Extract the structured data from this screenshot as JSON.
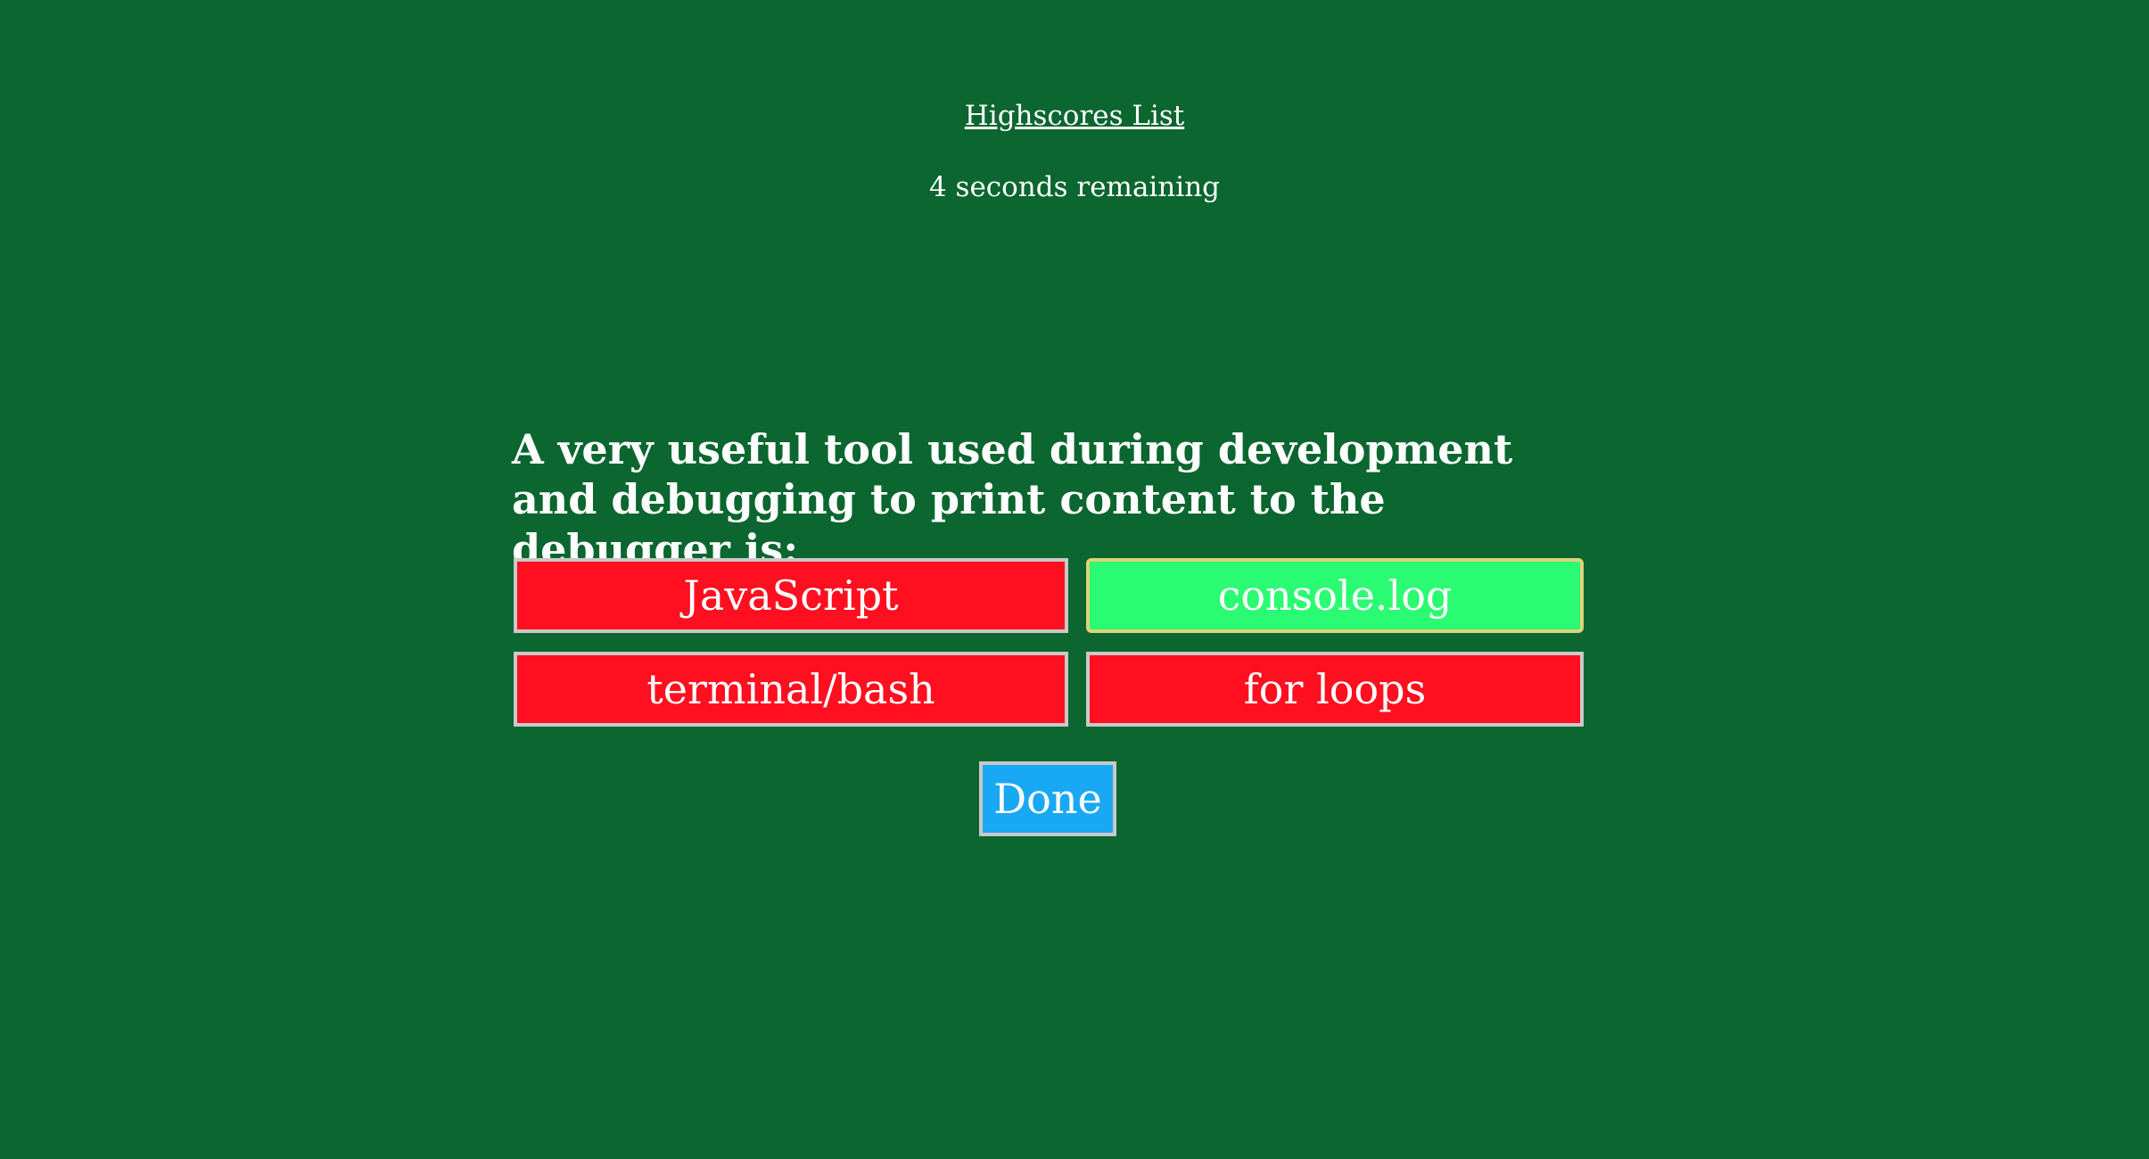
{
  "header": {
    "highscores_link": "Highscores List",
    "timer_text": "4 seconds remaining"
  },
  "quiz": {
    "question": "A very useful tool used during development and debugging to print content to the debugger is:",
    "choices": [
      {
        "label": "JavaScript",
        "state": "incorrect"
      },
      {
        "label": "console.log",
        "state": "correct"
      },
      {
        "label": "terminal/bash",
        "state": "incorrect"
      },
      {
        "label": "for loops",
        "state": "incorrect"
      }
    ],
    "done_label": "Done"
  },
  "colors": {
    "background": "#0b662f",
    "incorrect": "#ff0f1f",
    "correct": "#2bfb72",
    "done": "#19a8f4",
    "text": "#ffffff"
  }
}
